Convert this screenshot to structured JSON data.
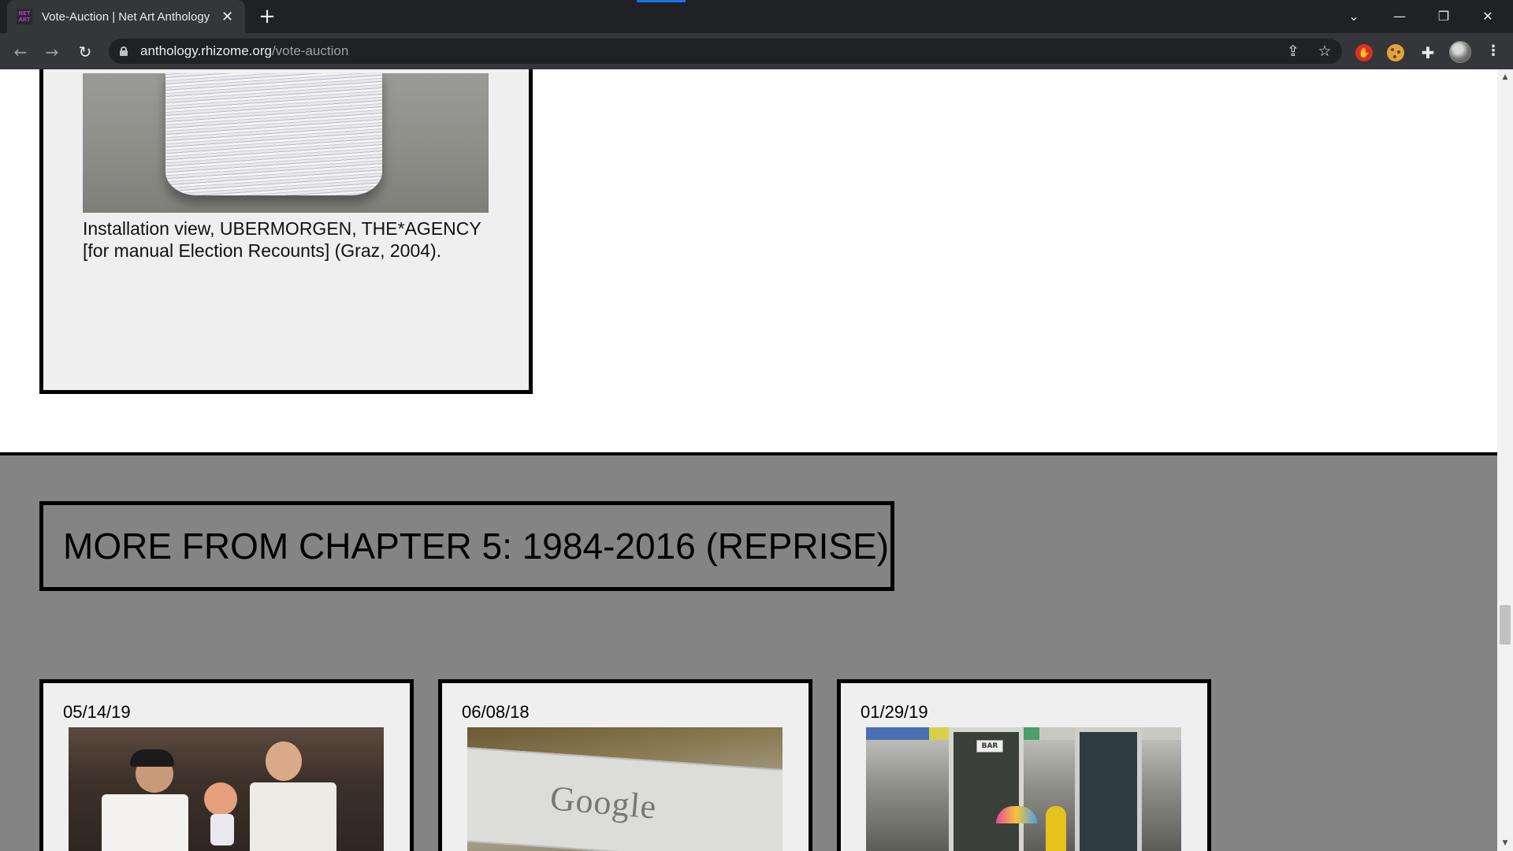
{
  "browser": {
    "tab_title": "Vote-Auction | Net Art Anthology",
    "favicon_text": "NET ART",
    "new_tab_symbol": "+",
    "close_symbol": "✕",
    "url_host": "anthology.rhizome.org",
    "url_path": "/vote-auction",
    "window_controls": [
      "chevron-down-icon",
      "minimize-icon",
      "restore-icon",
      "close-icon"
    ]
  },
  "figure": {
    "caption": "Installation view, UBERMORGEN, THE*AGENCY [for manual Election Recounts] (Graz, 2004)."
  },
  "more_section": {
    "title": "MORE FROM CHAPTER 5: 1984-2016 (REPRISE)",
    "cards": [
      {
        "date": "05/14/19"
      },
      {
        "date": "06/08/18"
      },
      {
        "date": "01/29/19",
        "sign_text": "BAR"
      }
    ],
    "google_logo_text": "Google"
  }
}
